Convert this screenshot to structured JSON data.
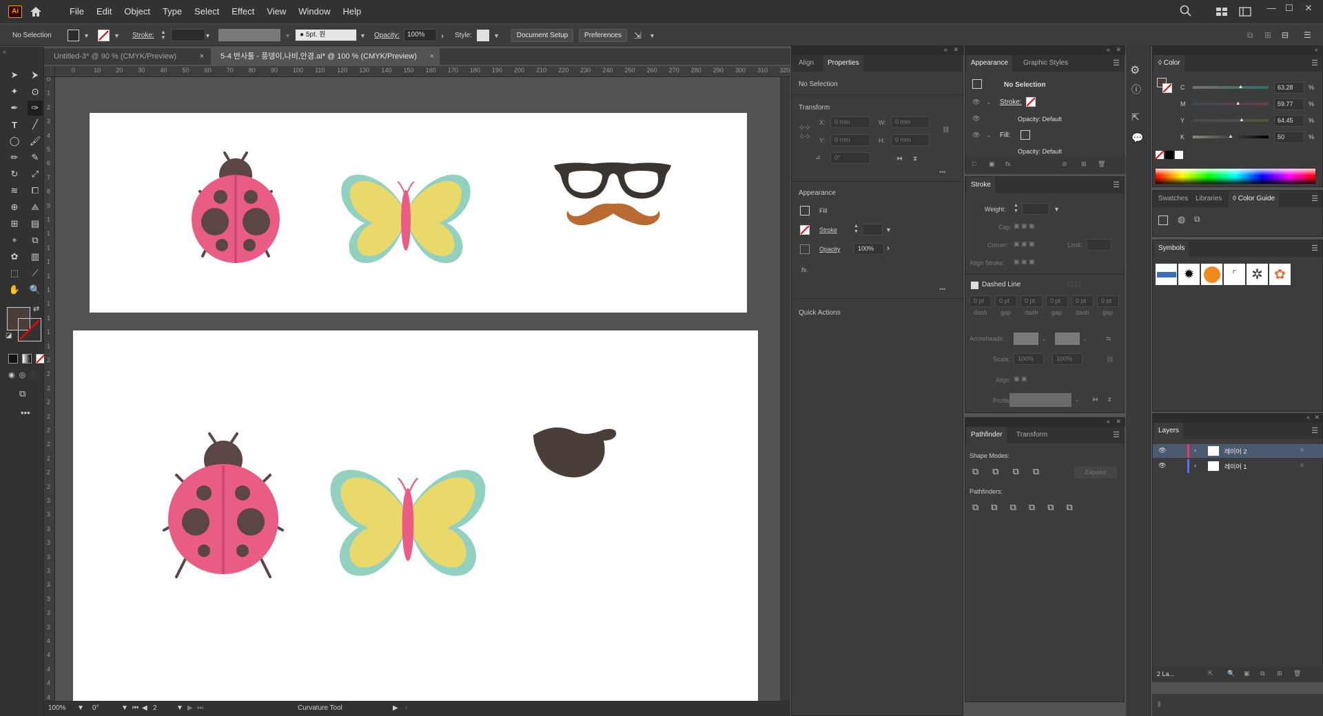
{
  "app": {
    "logo_text": "Ai",
    "menus": [
      "File",
      "Edit",
      "Object",
      "Type",
      "Select",
      "Effect",
      "View",
      "Window",
      "Help"
    ]
  },
  "controlbar": {
    "selection_label": "No Selection",
    "stroke_label": "Stroke:",
    "brush_label": "5pt. 원",
    "opacity_label": "Opacity:",
    "opacity_value": "100%",
    "style_label": "Style:",
    "document_setup": "Document Setup",
    "preferences": "Preferences"
  },
  "tabs": [
    {
      "label": "Untitled-3* @ 90 % (CMYK/Preview)",
      "close": "×"
    },
    {
      "label": "5-4 반사툴 - 풍뎅이,나비,안경.ai* @ 100 % (CMYK/Preview)",
      "close": "×"
    }
  ],
  "ruler_h": [
    "0",
    "10",
    "20",
    "30",
    "40",
    "50",
    "60",
    "70",
    "80",
    "90",
    "100",
    "110",
    "120",
    "130",
    "140",
    "150",
    "160",
    "170",
    "180",
    "190",
    "200",
    "210",
    "220",
    "230",
    "240",
    "250",
    "260",
    "270",
    "280",
    "290",
    "300",
    "310",
    "320"
  ],
  "ruler_v": [
    "0",
    "1",
    "2",
    "3",
    "4",
    "5",
    "6",
    "7",
    "8",
    "9",
    "1",
    "1",
    "1",
    "1",
    "1",
    "1",
    "1",
    "1",
    "1",
    "1",
    "2",
    "2",
    "2",
    "2",
    "2",
    "2",
    "2",
    "2",
    "2",
    "2",
    "3",
    "3",
    "3",
    "3",
    "3",
    "3",
    "3",
    "3",
    "3",
    "3",
    "4",
    "4",
    "4",
    "4",
    "4"
  ],
  "statusbar": {
    "zoom": "100%",
    "rotation": "0°",
    "artboard": "2",
    "tool": "Curvature Tool"
  },
  "properties_panel": {
    "tabs": [
      "Align",
      "Properties"
    ],
    "selection": "No Selection",
    "transform_title": "Transform",
    "x_label": "X:",
    "x_value": "0 mm",
    "y_label": "Y:",
    "y_value": "0 mm",
    "w_label": "W:",
    "w_value": "0 mm",
    "h_label": "H:",
    "h_value": "0 mm",
    "angle_value": "0°",
    "appearance_title": "Appearance",
    "fill_label": "Fill",
    "stroke_label": "Stroke",
    "opacity_label": "Opacity",
    "opacity_value": "100%",
    "fx": "fx.",
    "more": "•••",
    "quick_actions": "Quick Actions"
  },
  "appearance_panel": {
    "tabs": [
      "Appearance",
      "Graphic Styles"
    ],
    "selection": "No Selection",
    "stroke_label": "Stroke:",
    "opacity1": "Opacity: Default",
    "fill_label": "Fill:",
    "opacity2": "Opacity: Default",
    "fx": "fx."
  },
  "stroke_panel": {
    "title": "Stroke",
    "weight_label": "Weight:",
    "cap_label": "Cap:",
    "corner_label": "Corner:",
    "limit_label": "Limit:",
    "align_label": "Align Stroke:",
    "dashed_label": "Dashed Line",
    "dash_values": [
      "0 pt",
      "0 pt",
      "0 pt",
      "0 pt",
      "0 pt",
      "0 pt"
    ],
    "dash_labels": [
      "dash",
      "gap",
      "dash",
      "gap",
      "dash",
      "gap"
    ],
    "arrowheads_label": "Arrowheads:",
    "scale_label": "Scale:",
    "scale1": "100%",
    "scale2": "100%",
    "align_arrow_label": "Align:",
    "profile_label": "Profile:"
  },
  "pathfinder_panel": {
    "tabs": [
      "Pathfinder",
      "Transform"
    ],
    "shape_modes": "Shape Modes:",
    "expand": "Expand",
    "pathfinders": "Pathfinders:"
  },
  "color_panel": {
    "title": "Color",
    "channels": [
      {
        "label": "C",
        "value": "63.28",
        "unit": "%",
        "level": 0.633
      },
      {
        "label": "M",
        "value": "59.77",
        "unit": "%",
        "level": 0.598
      },
      {
        "label": "Y",
        "value": "64.45",
        "unit": "%",
        "level": 0.645
      },
      {
        "label": "K",
        "value": "50",
        "unit": "%",
        "level": 0.5
      }
    ]
  },
  "swatches_panel": {
    "tabs": [
      "Swatches",
      "Libraries",
      "Color Guide"
    ]
  },
  "symbols_panel": {
    "title": "Symbols"
  },
  "layers_panel": {
    "title": "Layers",
    "layers": [
      {
        "name": "레이어 2",
        "color": "#e8365c"
      },
      {
        "name": "레이어 1",
        "color": "#4f73ff"
      }
    ],
    "count": "2 La..."
  },
  "colors": {
    "ladybug_body": "#e95c83",
    "ladybug_dark": "#5b4545",
    "butterfly_wing": "#e9d96a",
    "butterfly_edge": "#92d0c2",
    "butterfly_body": "#e95c83",
    "glasses": "#3b3532",
    "mustache": "#b86a30",
    "shape_dark": "#4a3f38"
  }
}
